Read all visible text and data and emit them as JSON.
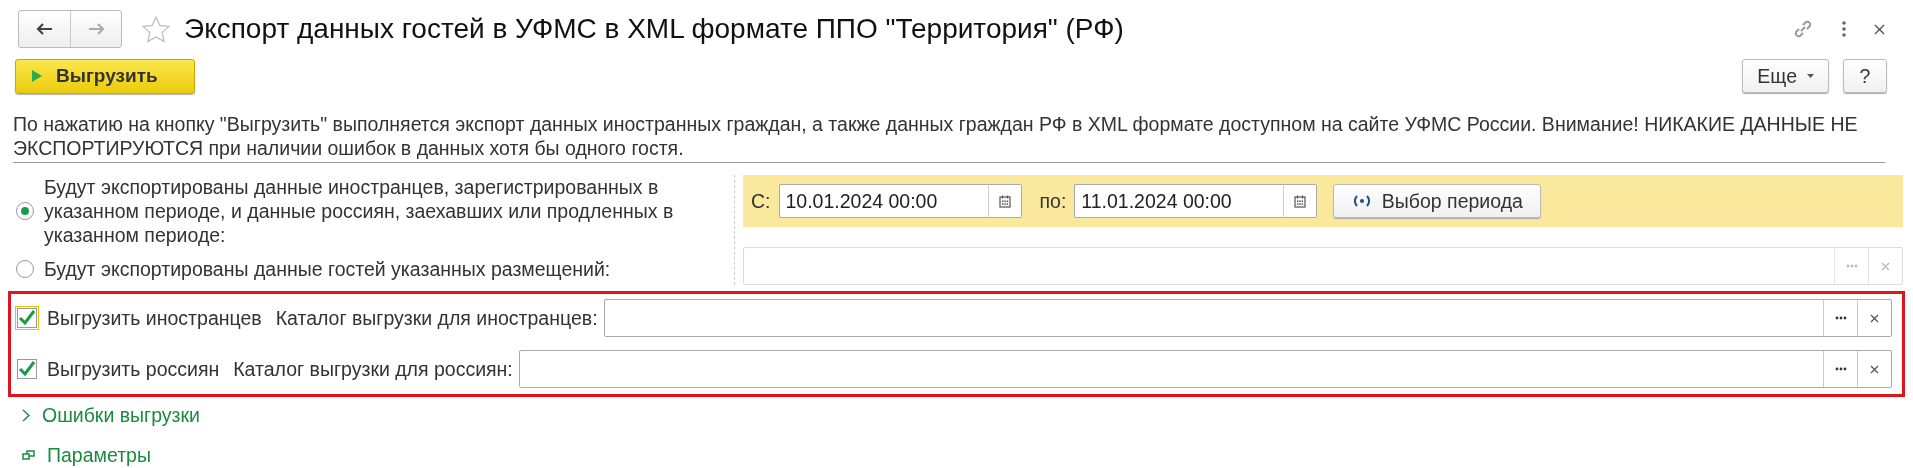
{
  "window": {
    "title": "Экспорт данных гостей в УФМС в XML формате ППО \"Территория\" (РФ)",
    "favorite": false
  },
  "toolbar": {
    "primary_button": "Выгрузить",
    "more_button": "Еще",
    "help_button": "?"
  },
  "description": "По нажатию на кнопку \"Выгрузить\" выполняется экспорт данных иностранных граждан, а также данных граждан РФ в XML формате доступном на сайте УФМС России. Внимание! НИКАКИЕ ДАННЫЕ НЕ ЭКСПОРТИРУЮТСЯ при наличии ошибок в данных хотя бы одного гостя.",
  "modes": [
    {
      "label": "Будут экспортированы данные иностранцев, зарегистрированных в указанном периоде, и данные россиян, заехавших или продленных в указанном периоде:",
      "selected": true
    },
    {
      "label": "Будут экспортированы данные гостей указанных размещений:",
      "selected": false
    }
  ],
  "period": {
    "from_label": "С:",
    "from_value": "10.01.2024 00:00",
    "to_label": "по:",
    "to_value": "11.01.2024 00:00",
    "button": "Выбор периода"
  },
  "placements_field": {
    "disabled": true
  },
  "exports": [
    {
      "label": "Выгрузить иностранцев",
      "checked": true,
      "focused": true,
      "folder_label": "Каталог выгрузки для иностранцев:"
    },
    {
      "label": "Выгрузить россиян",
      "checked": true,
      "focused": false,
      "folder_label": "Каталог выгрузки для россиян:"
    }
  ],
  "sections": [
    {
      "kind": "collapsible",
      "label": "Ошибки выгрузки"
    },
    {
      "kind": "group",
      "label": "Параметры"
    }
  ]
}
